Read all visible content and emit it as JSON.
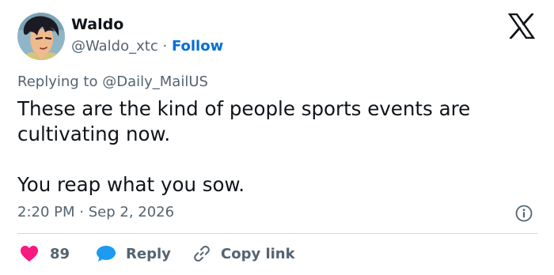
{
  "author": {
    "display_name": "Waldo",
    "handle": "@Waldo_xtc",
    "separator": "·",
    "follow_label": "Follow",
    "avatar_icon": "user-avatar-anime"
  },
  "brand_icon": "x-logo-icon",
  "reply_context": {
    "prefix": "Replying to",
    "mention": "@Daily_MailUS"
  },
  "tweet": {
    "lines": [
      "These are the kind of people sports events are cultivating now.",
      "You reap what you sow."
    ]
  },
  "meta": {
    "time": "2:20 PM",
    "separator": "·",
    "date": "Sep 2, 2026",
    "info_icon": "info-icon"
  },
  "actions": {
    "like_count": "89",
    "reply_label": "Reply",
    "copy_link_label": "Copy link"
  },
  "colors": {
    "text": "#0f1419",
    "secondary": "#536471",
    "link": "#006fd6",
    "like": "#f91880",
    "reply": "#1d9bf0",
    "divider": "#cfd9de"
  }
}
